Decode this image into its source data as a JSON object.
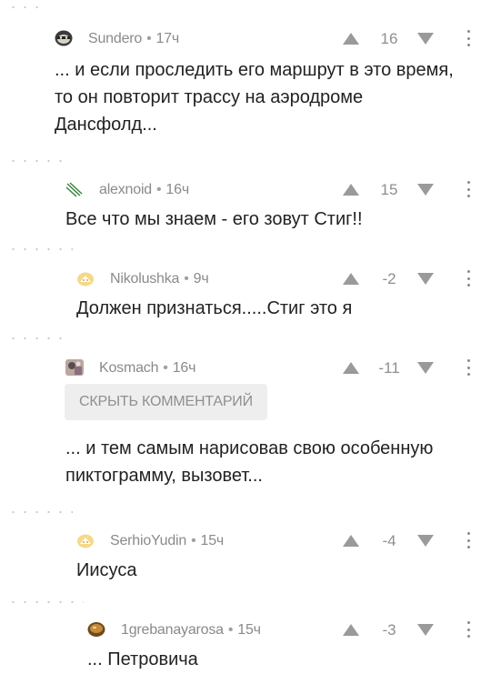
{
  "comments": [
    {
      "author": "Sundero",
      "time": "17ч",
      "score": "16",
      "text": "... и если проследить его маршрут в это время, то он повторит трассу на аэродроме Дансфолд...",
      "avatar_icon": "masked-face-avatar"
    },
    {
      "author": "alexnoid",
      "time": "16ч",
      "score": "15",
      "text": "Все что мы знаем - его зовут Стиг!!",
      "avatar_icon": "green-slashes-avatar"
    },
    {
      "author": "Nikolushka",
      "time": "9ч",
      "score": "-2",
      "text": "Должен признаться.....Стиг это я",
      "avatar_icon": "default-yellow-avatar"
    },
    {
      "author": "Kosmach",
      "time": "16ч",
      "score": "-11",
      "hide_label": "СКРЫТЬ КОММЕНТАРИЙ",
      "text": "... и тем самым нарисовав свою особенную пиктограмму, вызовет...",
      "avatar_icon": "photo-avatar"
    },
    {
      "author": "SerhioYudin",
      "time": "15ч",
      "score": "-4",
      "text": "Иисуса",
      "avatar_icon": "default-yellow-avatar"
    },
    {
      "author": "1grebanayarosa",
      "time": "15ч",
      "score": "-3",
      "text": "... Петровича",
      "avatar_icon": "bread-avatar"
    }
  ],
  "separator": "•",
  "colors": {
    "text": "#222222",
    "meta": "#8a8a8a",
    "vote": "#9a9a9a",
    "button_bg": "#eeeeee"
  }
}
